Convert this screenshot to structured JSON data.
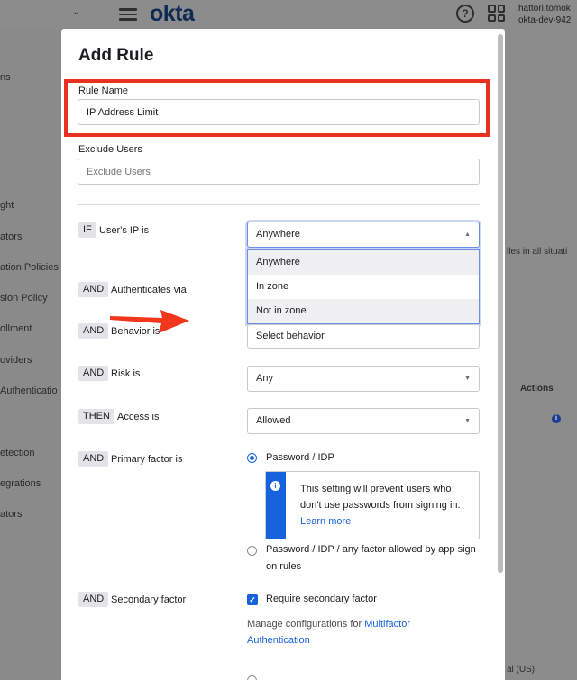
{
  "header": {
    "logo": "okta",
    "user_name": "hattori.tomok",
    "org_name": "okta-dev-942",
    "help_icon": "question-circle-icon",
    "apps_icon": "grid-icon"
  },
  "sidebar_fragments": [
    "ns",
    "ght",
    "ators",
    "ation Policies",
    "sion Policy",
    "ollment",
    "oviders",
    "Authenticatio",
    "etection",
    "egrations",
    "ators"
  ],
  "background_fragments": {
    "policy_text": "lles in all situati",
    "actions_header": "Actions",
    "footer_text": "al (US)"
  },
  "modal": {
    "title": "Add Rule",
    "rule_name": {
      "label": "Rule Name",
      "value": "IP Address Limit"
    },
    "exclude_users": {
      "label": "Exclude Users",
      "value": "Exclude Users"
    },
    "conditions": {
      "if_badge": "IF",
      "ip_label": "User's IP is",
      "ip_selected": "Anywhere",
      "ip_options": [
        "Anywhere",
        "In zone",
        "Not in zone"
      ],
      "auth_badge": "AND",
      "auth_label": "Authenticates via",
      "behavior_badge": "AND",
      "behavior_label": "Behavior is",
      "behavior_value": "Select behavior",
      "risk_badge": "AND",
      "risk_label": "Risk is",
      "risk_value": "Any",
      "then_badge": "THEN",
      "access_label": "Access is",
      "access_value": "Allowed",
      "primary_badge": "AND",
      "primary_label": "Primary factor is",
      "primary_option_1": "Password / IDP",
      "callout_text": "This setting will prevent users who don't use passwords from signing in.",
      "callout_link": "Learn more",
      "primary_option_2_line1": "Password / IDP / any factor allowed by app sign",
      "primary_option_2_line2": "on rules",
      "secondary_badge": "AND",
      "secondary_label": "Secondary factor",
      "secondary_checkbox": "Require secondary factor",
      "manage_text": "Manage configurations for",
      "manage_link_1": "Multifactor",
      "manage_link_2": "Authentication"
    }
  },
  "colors": {
    "accent": "#1662dd",
    "highlight": "#e8321f",
    "overlay": "#8a8a8a"
  }
}
